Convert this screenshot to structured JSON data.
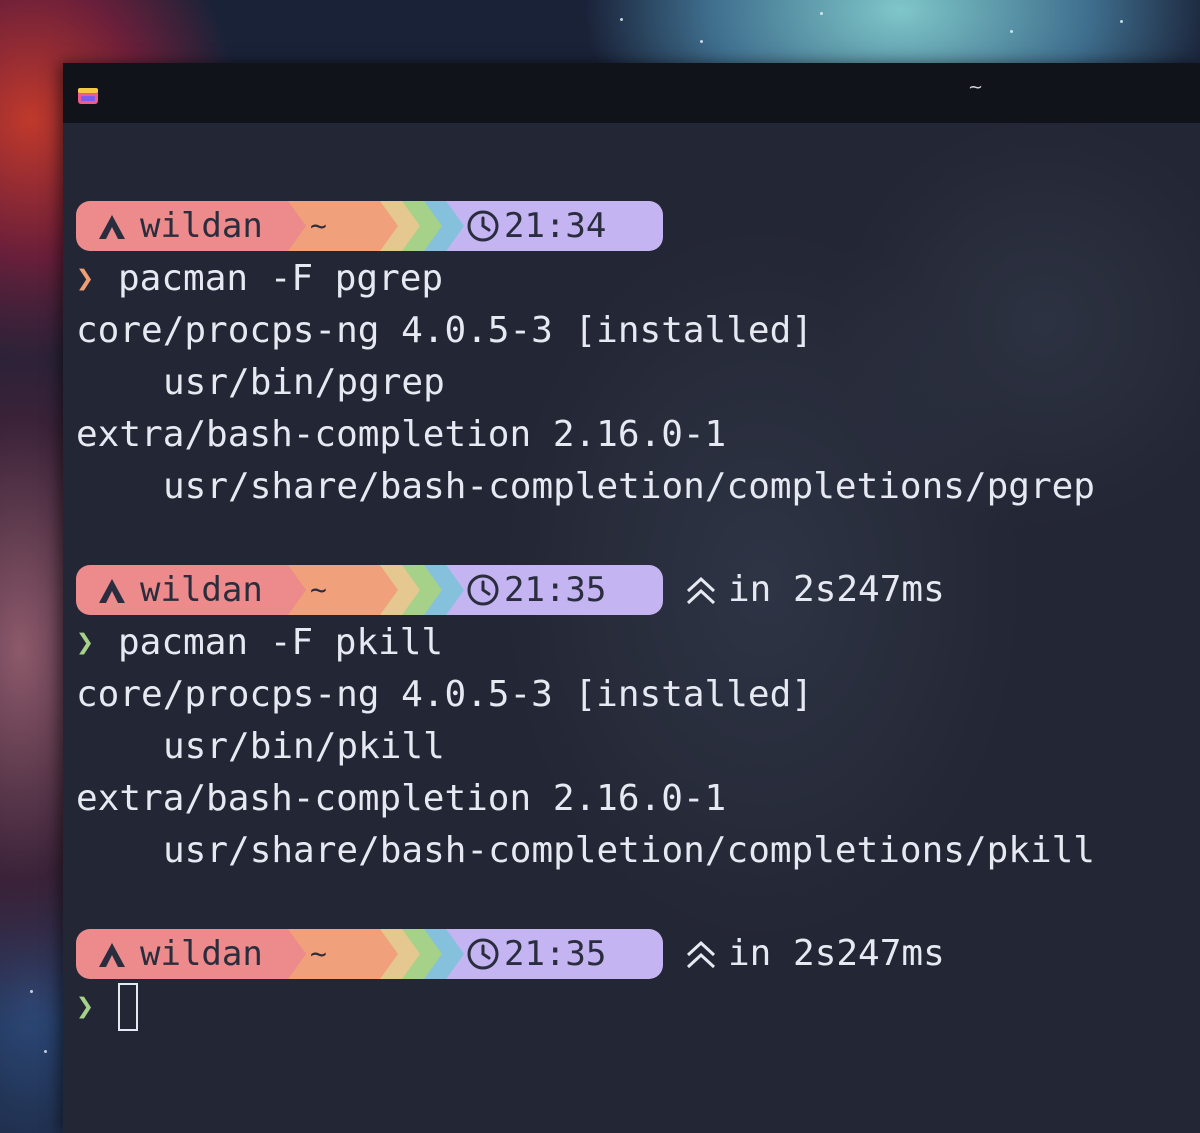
{
  "window": {
    "title": "~"
  },
  "icons": {
    "app": "terminal-app-icon",
    "user": "arch-linux-icon",
    "clock": "clock-icon",
    "duration": "double-chevron-up-icon",
    "prompt": "prompt-chevron-icon"
  },
  "colors": {
    "terminal_bg": "#232634",
    "user_segment": "#ec8a8c",
    "dir_segment": "#f0a07a",
    "yellow": "#e5c890",
    "green": "#a6d189",
    "blue": "#85c1dc",
    "time_segment": "#c4b4f2",
    "prompt_chevron_error": "#ef9f76",
    "prompt_chevron_ok": "#a6d189",
    "text": "#e6e9f2"
  },
  "blocks": [
    {
      "prompt": {
        "user": "wildan",
        "dir": "~",
        "time": "21:34",
        "duration": ""
      },
      "command": "pacman -F pgrep",
      "output": [
        {
          "text": "core/procps-ng 4.0.5-3 [installed]",
          "indent": false
        },
        {
          "text": "usr/bin/pgrep",
          "indent": true
        },
        {
          "text": "extra/bash-completion 2.16.0-1",
          "indent": false
        },
        {
          "text": "usr/share/bash-completion/completions/pgrep",
          "indent": true
        }
      ]
    },
    {
      "prompt": {
        "user": "wildan",
        "dir": "~",
        "time": "21:35",
        "duration": "in 2s247ms"
      },
      "command": "pacman -F pkill",
      "output": [
        {
          "text": "core/procps-ng 4.0.5-3 [installed]",
          "indent": false
        },
        {
          "text": "usr/bin/pkill",
          "indent": true
        },
        {
          "text": "extra/bash-completion 2.16.0-1",
          "indent": false
        },
        {
          "text": "usr/share/bash-completion/completions/pkill",
          "indent": true
        }
      ]
    },
    {
      "prompt": {
        "user": "wildan",
        "dir": "~",
        "time": "21:35",
        "duration": "in 2s247ms"
      },
      "command": "",
      "output": []
    }
  ]
}
